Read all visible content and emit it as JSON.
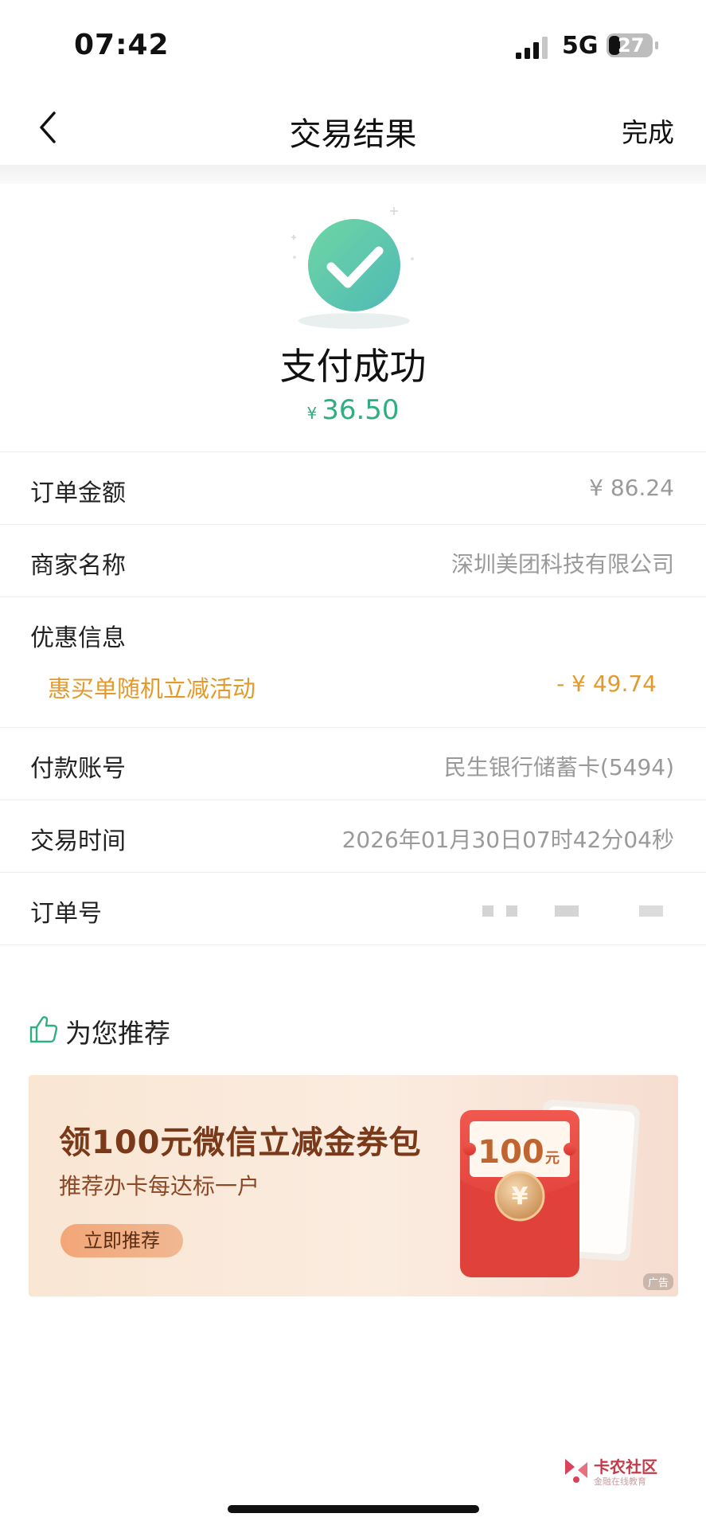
{
  "status_bar": {
    "time": "07:42",
    "network": "5G",
    "battery": "27"
  },
  "nav": {
    "back_icon": "chevron-left-icon",
    "title": "交易结果",
    "done_label": "完成"
  },
  "result": {
    "icon": "check-circle-icon",
    "title": "支付成功",
    "currency": "¥",
    "amount": "36.50",
    "accent_color": "#2fae7f"
  },
  "details": {
    "order_amount": {
      "label": "订单金额",
      "value": "¥ 86.24"
    },
    "merchant": {
      "label": "商家名称",
      "value": "深圳美团科技有限公司"
    },
    "discount": {
      "label": "优惠信息",
      "item": "惠买单随机立减活动",
      "value": "- ¥ 49.74",
      "color": "#e39a2c"
    },
    "account": {
      "label": "付款账号",
      "value": "民生银行储蓄卡(5494)"
    },
    "time": {
      "label": "交易时间",
      "value": "2026年01月30日07时42分04秒"
    },
    "order_no": {
      "label": "订单号"
    }
  },
  "recommend": {
    "icon": "thumbs-up-icon",
    "title": "为您推荐",
    "banner": {
      "title": "领100元微信立减金券包",
      "subtitle": "推荐办卡每达标一户",
      "button": "立即推荐",
      "coupon_amount": "100",
      "coupon_unit": "元",
      "coin_symbol": "¥",
      "ad_tag": "广告"
    }
  },
  "watermark": {
    "title": "卡农社区",
    "subtitle": "金融在线教育"
  }
}
